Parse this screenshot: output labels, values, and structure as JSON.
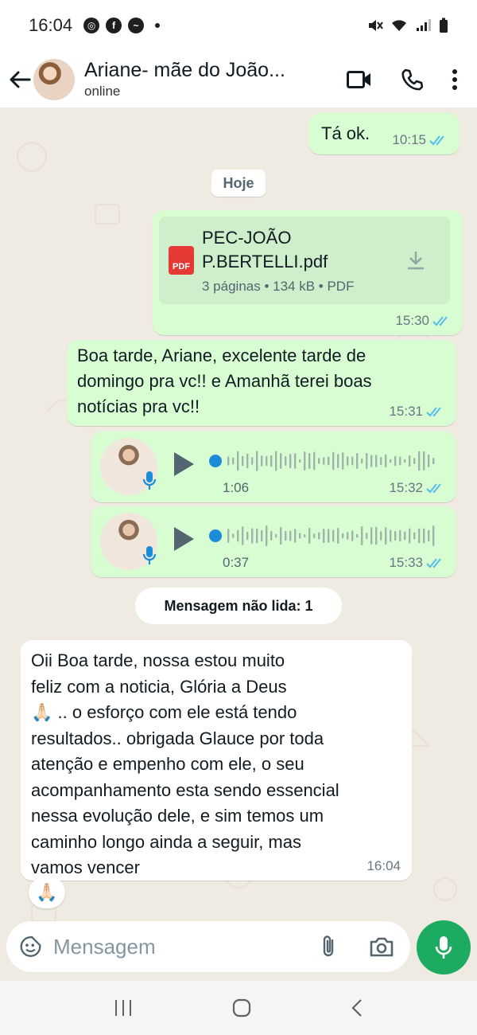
{
  "status_bar": {
    "time": "16:04",
    "icons_left": [
      "chrome-icon",
      "facebook-icon",
      "messenger-icon",
      "dot-icon"
    ],
    "icons_right": [
      "mute-icon",
      "wifi-icon",
      "signal-icon",
      "battery-icon"
    ]
  },
  "header": {
    "contact_name": "Ariane- mãe do João...",
    "status": "online",
    "actions": [
      "video-call-icon",
      "voice-call-icon",
      "more-options-icon"
    ]
  },
  "chat": {
    "messages": [
      {
        "type": "text",
        "direction": "out",
        "text": "Tá ok.",
        "time": "10:15",
        "read": true
      },
      {
        "type": "date_chip",
        "label": "Hoje"
      },
      {
        "type": "document",
        "direction": "out",
        "file_name_line1": "PEC-JOÃO",
        "file_name_line2": "P.BERTELLI.pdf",
        "file_meta": "3 páginas • 134 kB • PDF",
        "icon_label": "PDF",
        "time": "15:30",
        "read": true
      },
      {
        "type": "text",
        "direction": "out",
        "lines": [
          "Boa tarde, Ariane, excelente tarde de",
          "domingo pra vc!! e Amanhã terei boas",
          "notícias pra vc!!"
        ],
        "time": "15:31",
        "read": true
      },
      {
        "type": "voice",
        "direction": "out",
        "duration": "1:06",
        "time": "15:32",
        "read": true
      },
      {
        "type": "voice",
        "direction": "out",
        "duration": "0:37",
        "time": "15:33",
        "read": true
      },
      {
        "type": "unread_chip",
        "label": "Mensagem não lida: 1"
      },
      {
        "type": "text",
        "direction": "in",
        "lines": [
          "Oii Boa tarde, nossa estou muito",
          "feliz com a noticia, Glória a Deus",
          "🙏🏻 .. o esforço com ele está tendo",
          "resultados.. obrigada Glauce por toda",
          "atenção e empenho com ele, o seu",
          "acompanhamento esta sendo essencial",
          "nessa evolução dele, e  sim temos um",
          "caminho longo ainda a seguir, mas",
          "vamos vencer"
        ],
        "time": "16:04",
        "reaction": "🙏🏻"
      }
    ]
  },
  "input": {
    "placeholder": "Mensagem",
    "icons": [
      "emoji-sticker-icon",
      "attach-icon",
      "camera-icon"
    ]
  },
  "colors": {
    "outgoing_bubble": "#d9fdd3",
    "incoming_bubble": "#ffffff",
    "accent_green": "#1daa61",
    "read_tick_blue": "#53bdeb",
    "chat_bg": "#efeae2"
  }
}
